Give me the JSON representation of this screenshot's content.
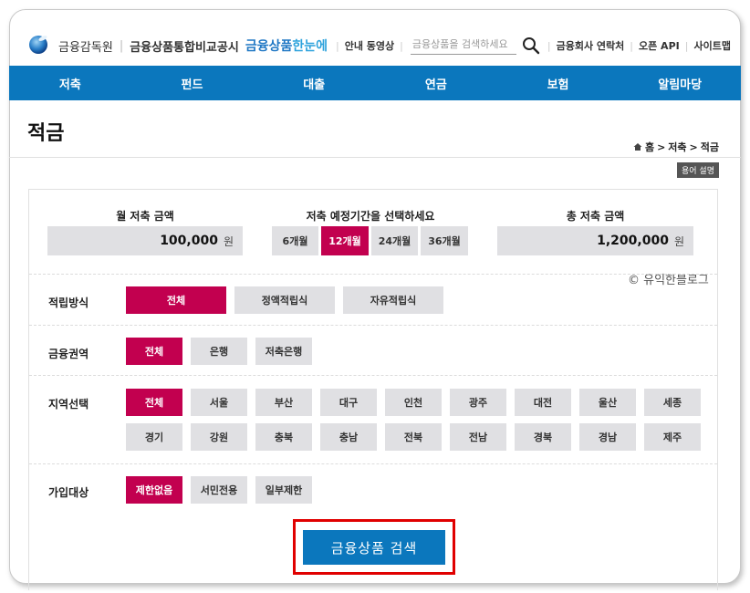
{
  "header": {
    "org": "금융감독원",
    "site": "금융상품통합비교공시",
    "brand_a": "금융상품",
    "brand_b": "한눈에",
    "util": {
      "guide_video": "안내 동영상",
      "search_placeholder": "금융상품을 검색하세요",
      "contacts": "금융회사 연락처",
      "open_api": "오픈 API",
      "sitemap": "사이트맵"
    }
  },
  "nav": [
    "저축",
    "펀드",
    "대출",
    "연금",
    "보험",
    "알림마당"
  ],
  "page": {
    "title": "적금",
    "breadcrumb": [
      "홈",
      "저축",
      "적금"
    ],
    "terms_button": "용어 설명"
  },
  "calculator": {
    "monthly_label": "월 저축 금액",
    "monthly_value": "100,000",
    "period_label": "저축 예정기간을 선택하세요",
    "periods": [
      "6개월",
      "12개월",
      "24개월",
      "36개월"
    ],
    "selected_period": "12개월",
    "total_label": "총 저축 금액",
    "total_value": "1,200,000",
    "unit": "원"
  },
  "filters": {
    "method": {
      "label": "적립방식",
      "options": [
        "전체",
        "정액적립식",
        "자유적립식"
      ],
      "selected": "전체"
    },
    "sector": {
      "label": "금융권역",
      "options": [
        "전체",
        "은행",
        "저축은행"
      ],
      "selected": "전체"
    },
    "region": {
      "label": "지역선택",
      "row1": [
        "전체",
        "서울",
        "부산",
        "대구",
        "인천",
        "광주",
        "대전",
        "울산",
        "세종"
      ],
      "row2": [
        "경기",
        "강원",
        "충북",
        "충남",
        "전북",
        "전남",
        "경북",
        "경남",
        "제주"
      ],
      "selected": "전체"
    },
    "target": {
      "label": "가입대상",
      "options": [
        "제한없음",
        "서민전용",
        "일부제한"
      ],
      "selected": "제한없음"
    }
  },
  "watermark": "© 유익한블로그",
  "search_button": "금융상품 검색",
  "colors": {
    "nav_blue": "#0b77bd",
    "active_magenta": "#c2004f",
    "highlight_red": "#e00000"
  }
}
